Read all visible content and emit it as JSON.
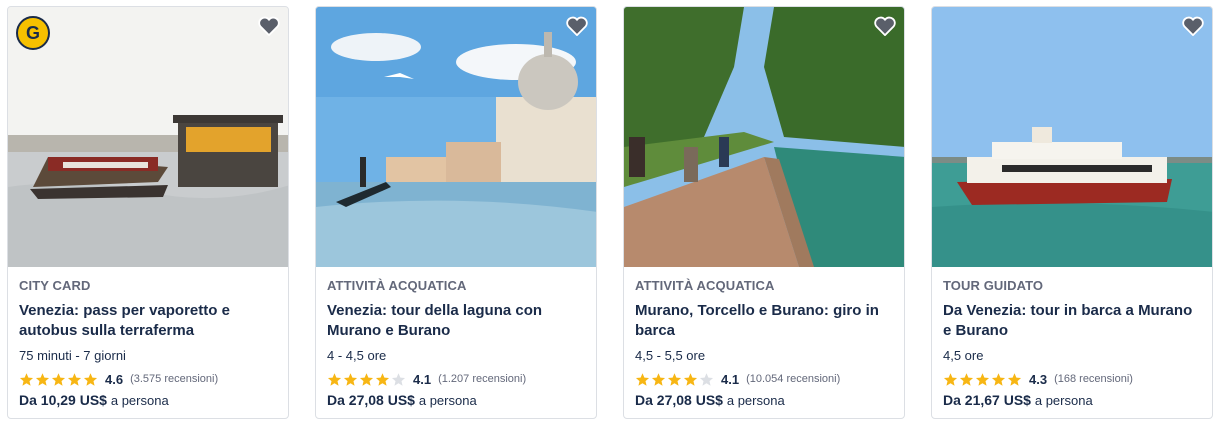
{
  "cards": [
    {
      "category": "CITY CARD",
      "title": "Venezia: pass per vaporetto e autobus sulla terraferma",
      "duration": "75 minuti - 7 giorni",
      "stars": 5,
      "score": "4.6",
      "reviews": "(3.575 recensioni)",
      "price_prefix": "Da",
      "price": "10,29 US$",
      "price_suffix": "a persona",
      "badge_letter": "G"
    },
    {
      "category": "ATTIVITÀ ACQUATICA",
      "title": "Venezia: tour della laguna con Murano e Burano",
      "duration": "4 - 4,5 ore",
      "stars": 4,
      "score": "4.1",
      "reviews": "(1.207 recensioni)",
      "price_prefix": "Da",
      "price": "27,08 US$",
      "price_suffix": "a persona"
    },
    {
      "category": "ATTIVITÀ ACQUATICA",
      "title": "Murano, Torcello e Burano: giro in barca",
      "duration": "4,5 - 5,5 ore",
      "stars": 4,
      "score": "4.1",
      "reviews": "(10.054 recensioni)",
      "price_prefix": "Da",
      "price": "27,08 US$",
      "price_suffix": "a persona"
    },
    {
      "category": "TOUR GUIDATO",
      "title": "Da Venezia: tour in barca a Murano e Burano",
      "duration": "4,5 ore",
      "stars": 5,
      "score": "4.3",
      "reviews": "(168 recensioni)",
      "price_prefix": "Da",
      "price": "21,67 US$",
      "price_suffix": "a persona"
    }
  ],
  "colors": {
    "star_filled": "#f7b614",
    "star_empty": "#dcdfe4",
    "text_dark": "#1a2b49",
    "text_muted": "#63687a"
  },
  "icons": {
    "wishlist": "heart-icon",
    "rating": "star-icon",
    "badge": "getyourguide-badge-icon"
  }
}
